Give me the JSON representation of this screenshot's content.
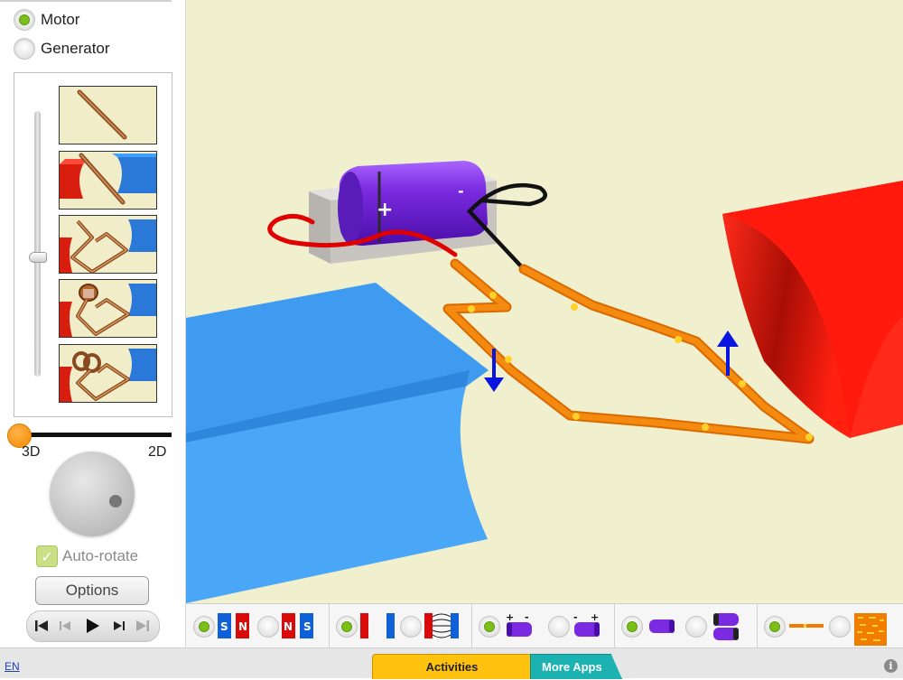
{
  "mode": {
    "options": [
      {
        "label": "Motor",
        "selected": true
      },
      {
        "label": "Generator",
        "selected": false
      }
    ]
  },
  "model_selector": {
    "items": [
      "straight-wire",
      "wire-between-magnets",
      "square-loop",
      "loop-with-commutator",
      "loop-with-split-rings"
    ],
    "selected_level": 0.55
  },
  "view": {
    "left_label": "3D",
    "right_label": "2D",
    "value": 0
  },
  "autorotate": {
    "label": "Auto-rotate",
    "checked": true,
    "mark": "✓"
  },
  "options_button": {
    "label": "Options"
  },
  "battery": {
    "plus": "+",
    "minus": "-"
  },
  "toolbar": {
    "magnet_poles": {
      "s": "S",
      "n": "N"
    },
    "battery_signs": {
      "plus": "+",
      "minus": "-"
    }
  },
  "footer": {
    "language": "EN",
    "tabs": [
      {
        "label": "Activities",
        "active": true
      },
      {
        "label": "More Apps",
        "active": false
      }
    ],
    "info": "i"
  },
  "colors": {
    "accent_green": "#7cbf1a",
    "activities_tab": "#ffc20e",
    "more_apps_tab": "#1db2b2",
    "canvas_bg": "#f0efce",
    "magnet_red": "#ff1a0d",
    "magnet_blue": "#3f9bef",
    "wire_orange": "#f07d00",
    "battery_purple": "#7a2ae0"
  }
}
